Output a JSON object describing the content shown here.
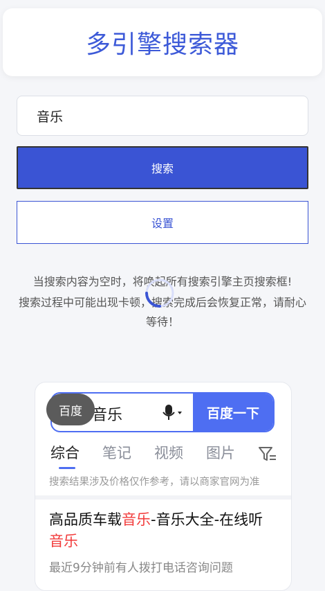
{
  "header": {
    "title": "多引擎搜索器"
  },
  "search": {
    "value": "音乐"
  },
  "buttons": {
    "search_label": "搜索",
    "settings_label": "设置"
  },
  "tips": [
    "当搜索内容为空时，将唤起所有搜索引擎主页搜索框!",
    "搜索过程中可能出现卡顿，搜索完成后会恢复正常，请耐心等待！"
  ],
  "colors": {
    "accent": "#3a54d4",
    "baidu_blue": "#4e6ef2",
    "highlight_red": "#f23b3b"
  },
  "engine_card": {
    "engine_chip": "百度",
    "query": "音乐",
    "submit_label": "百度一下",
    "tabs": [
      "综合",
      "笔记",
      "视频",
      "图片"
    ],
    "active_tab": "综合",
    "notice": "搜索结果涉及价格仅作参考，请以商家官网为准",
    "result": {
      "title_parts": [
        "高品质车载",
        "音乐",
        "-音乐大全-在线听",
        "音乐"
      ],
      "description": "最近9分钟前有人拨打电话咨询问题"
    },
    "icons": [
      "microphone-icon",
      "filter-icon"
    ]
  }
}
